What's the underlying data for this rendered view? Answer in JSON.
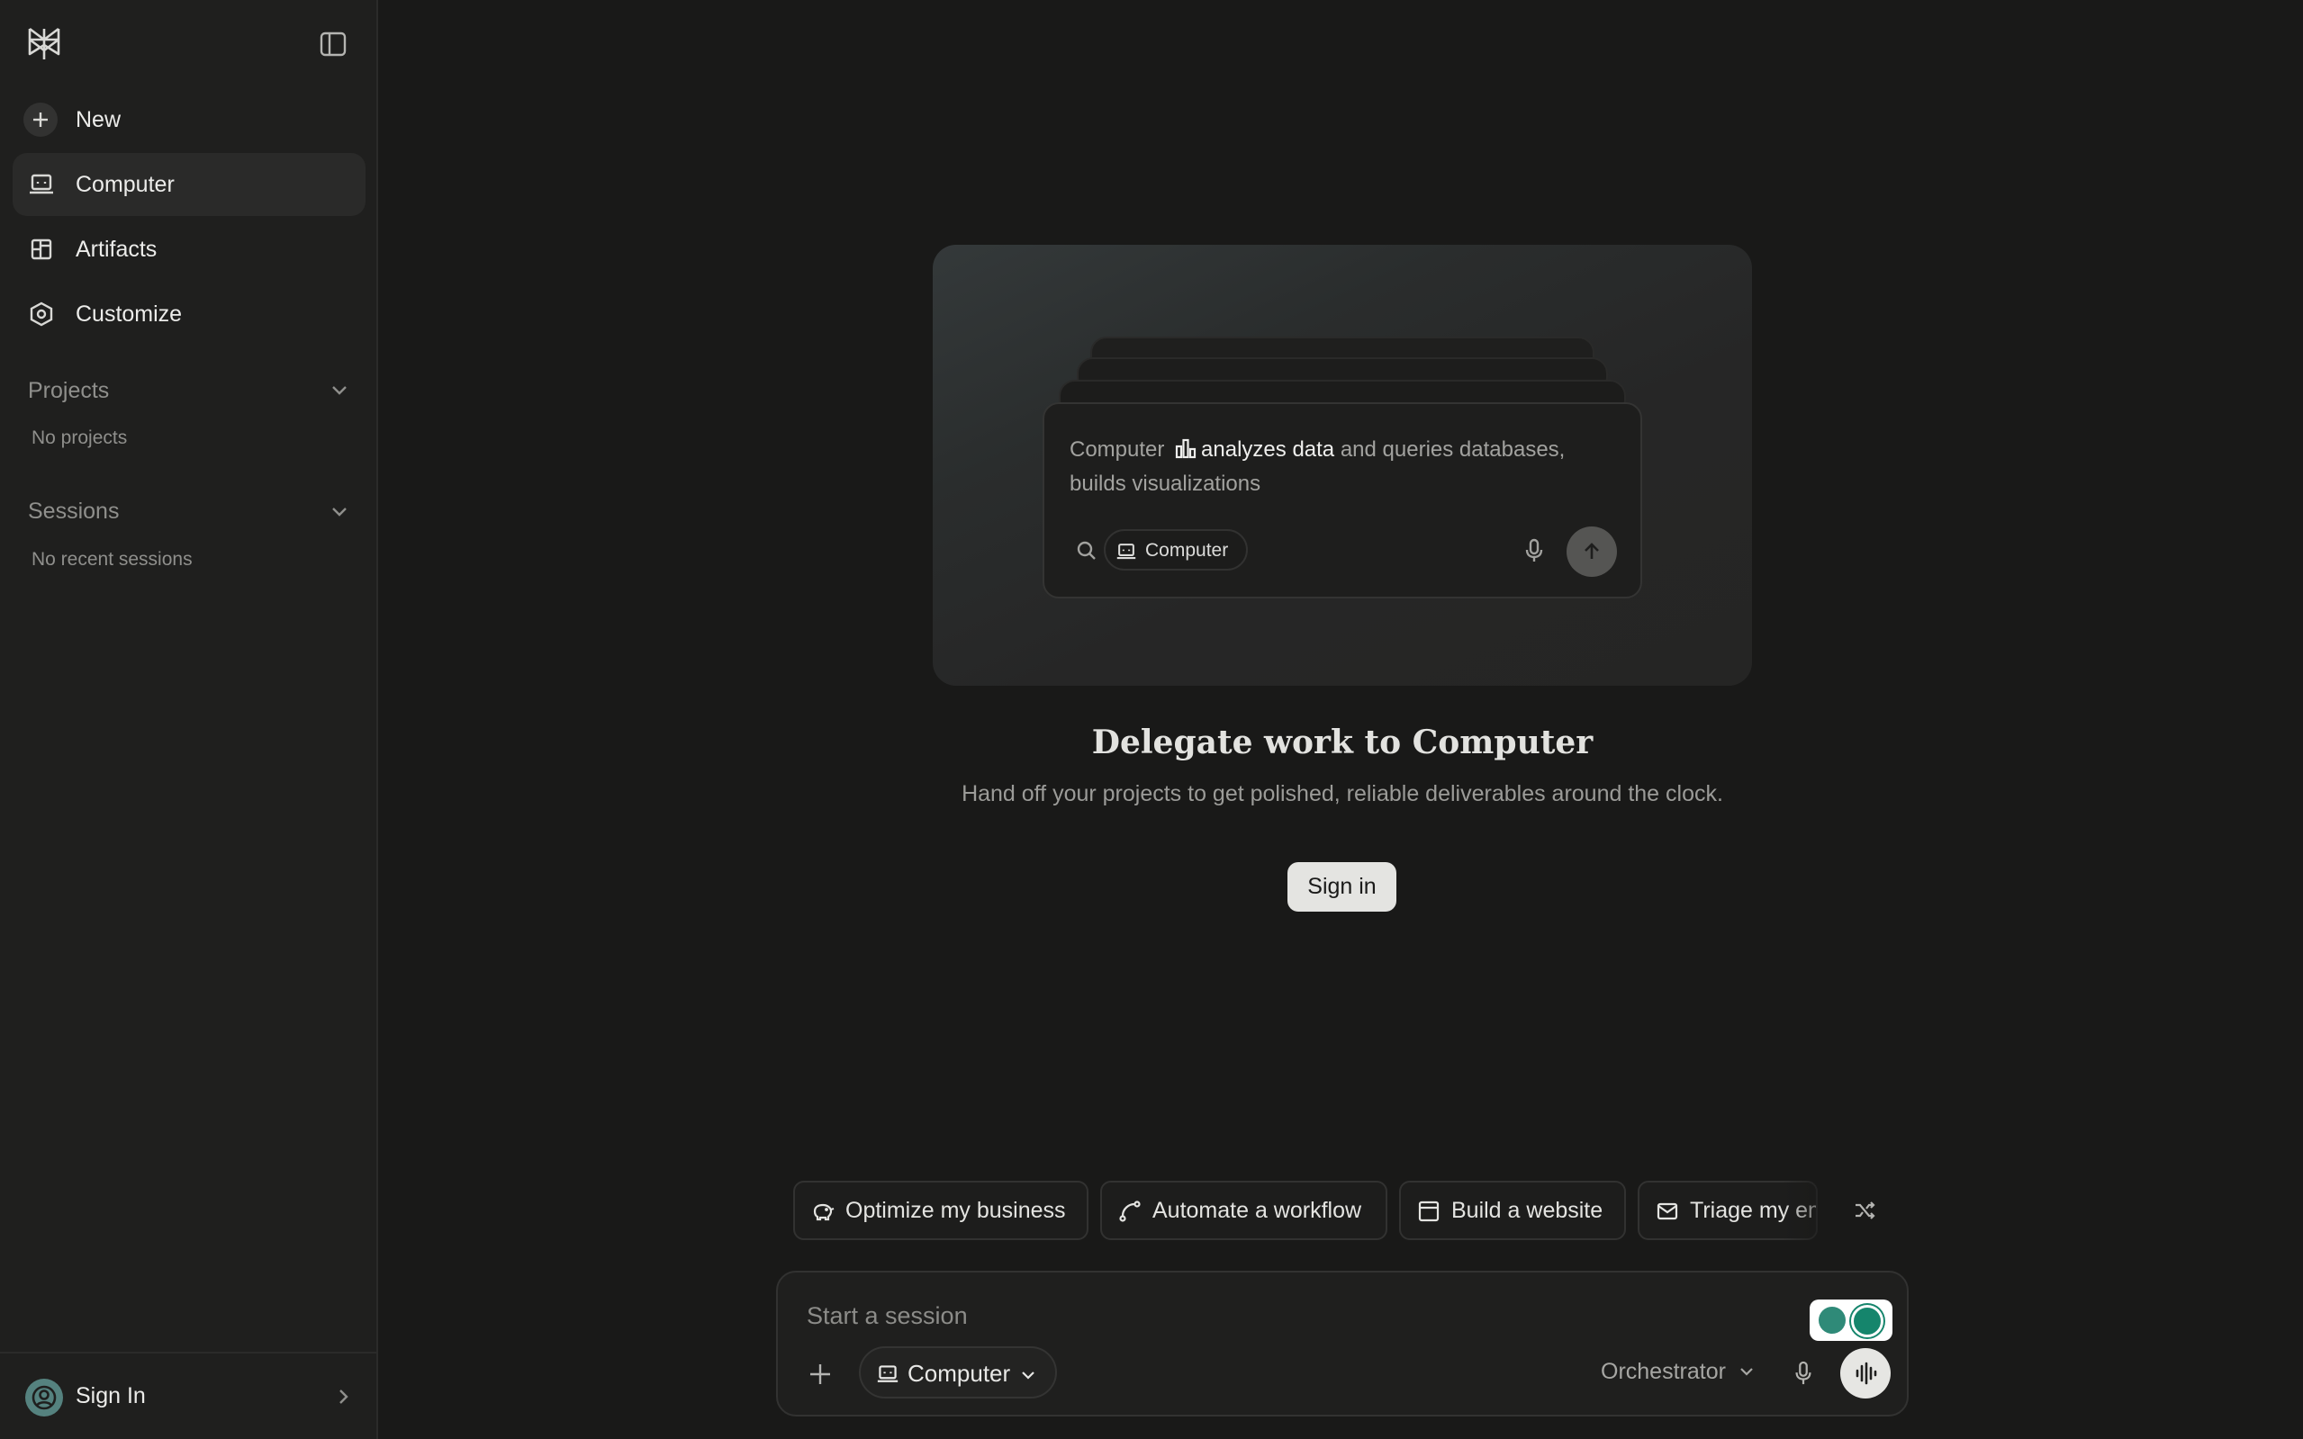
{
  "sidebar": {
    "nav": {
      "new": "New",
      "computer": "Computer",
      "artifacts": "Artifacts",
      "customize": "Customize"
    },
    "projects": {
      "title": "Projects",
      "empty": "No projects"
    },
    "sessions": {
      "title": "Sessions",
      "empty": "No recent sessions"
    },
    "footer": {
      "sign_in": "Sign In"
    }
  },
  "hero": {
    "preview": {
      "text_prefix": "Computer",
      "text_highlight": "analyzes data",
      "text_suffix": "and queries databases, builds visualizations",
      "chip": "Computer"
    },
    "title": "Delegate work to Computer",
    "subtitle": "Hand off your projects to get polished, reliable deliverables around the clock.",
    "sign_in": "Sign in"
  },
  "suggestions": [
    {
      "label": "Optimize my business",
      "icon": "piggy-bank-icon"
    },
    {
      "label": "Automate a workflow",
      "icon": "workflow-icon"
    },
    {
      "label": "Build a website",
      "icon": "browser-window-icon"
    },
    {
      "label": "Triage my em",
      "icon": "mail-icon"
    }
  ],
  "composer": {
    "placeholder": "Start a session",
    "mode": "Computer",
    "model": "Orchestrator"
  },
  "colors": {
    "background": "#191918",
    "sidebar": "#1f1f1e",
    "accent_avatar": "#55827f"
  }
}
